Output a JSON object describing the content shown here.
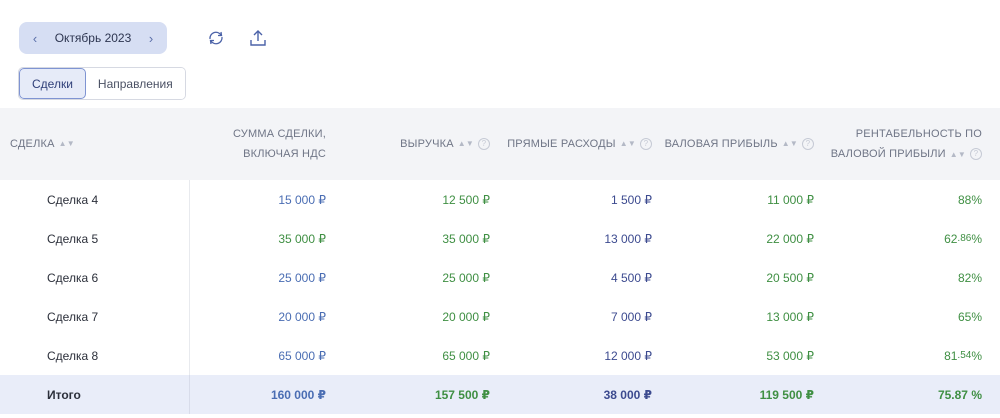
{
  "toolbar": {
    "month": "Октябрь 2023",
    "prev_icon": "chevron-left-icon",
    "next_icon": "chevron-right-icon",
    "refresh_icon": "refresh-icon",
    "export_icon": "upload-icon"
  },
  "tabs": [
    {
      "label": "Сделки",
      "active": true
    },
    {
      "label": "Направления",
      "active": false
    }
  ],
  "colors": {
    "accent": "#7f94d2",
    "value_blue": "#4a6db3",
    "value_green": "#3f8f43",
    "value_navy": "#3c4a8f",
    "total_row_bg": "#e9edf9"
  },
  "table": {
    "headers": {
      "deal": "Сделка",
      "amount": "Сумма сделки,",
      "amount_line2": "включая НДС",
      "revenue": "Выручка",
      "costs": "Прямые расходы",
      "gross_profit": "Валовая прибыль",
      "margin": "Рентабельность по",
      "margin_line2": "валовой прибыли"
    },
    "rows": [
      {
        "name": "Сделка 4",
        "amount": "15 000 ₽",
        "revenue": "12 500 ₽",
        "costs": "1 500 ₽",
        "profit": "11 000 ₽",
        "margin_int": "88",
        "margin_frac": "",
        "unit": " %"
      },
      {
        "name": "Сделка 5",
        "amount": "35 000 ₽",
        "revenue": "35 000 ₽",
        "costs": "13 000 ₽",
        "profit": "22 000 ₽",
        "margin_int": "62",
        "margin_frac": ".86",
        "unit": " %"
      },
      {
        "name": "Сделка 6",
        "amount": "25 000 ₽",
        "revenue": "25 000 ₽",
        "costs": "4 500 ₽",
        "profit": "20 500 ₽",
        "margin_int": "82",
        "margin_frac": "",
        "unit": " %"
      },
      {
        "name": "Сделка 7",
        "amount": "20 000 ₽",
        "revenue": "20 000 ₽",
        "costs": "7 000 ₽",
        "profit": "13 000 ₽",
        "margin_int": "65",
        "margin_frac": "",
        "unit": " %"
      },
      {
        "name": "Сделка 8",
        "amount": "65 000 ₽",
        "revenue": "65 000 ₽",
        "costs": "12 000 ₽",
        "profit": "53 000 ₽",
        "margin_int": "81",
        "margin_frac": ".54",
        "unit": " %"
      }
    ],
    "total": {
      "name": "Итого",
      "amount": "160 000 ₽",
      "revenue": "157 500 ₽",
      "costs": "38 000 ₽",
      "profit": "119 500 ₽",
      "margin": "75.87 %"
    }
  }
}
